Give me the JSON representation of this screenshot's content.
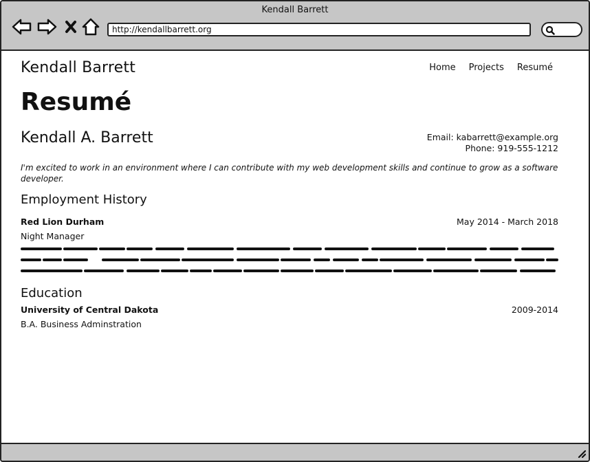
{
  "window": {
    "title": "Kendall Barrett"
  },
  "browser": {
    "url": "http://kendallbarrett.org",
    "icons": [
      "back-arrow-icon",
      "forward-arrow-icon",
      "stop-icon",
      "home-icon",
      "search-icon",
      "resize-grip-icon"
    ]
  },
  "site": {
    "title": "Kendall Barrett",
    "nav": [
      "Home",
      "Projects",
      "Resumé"
    ]
  },
  "resume": {
    "heading": "Resumé",
    "name": "Kendall A. Barrett",
    "email": "Email: kabarrett@example.org",
    "phone": "Phone: 919-555-1212",
    "objective": "I'm excited to work in an environment where I can contribute with my web development skills and continue to grow as a software developer.",
    "employment": {
      "heading": "Employment History",
      "org": "Red Lion Durham",
      "dates": "May 2014 - March 2018",
      "role": "Night Manager"
    },
    "education": {
      "heading": "Education",
      "org": "University of Central Dakota",
      "dates": "2009-2014",
      "degree": "B.A. Business Adminstration"
    }
  },
  "colors": {
    "chrome": "#c6c6c6",
    "border": "#222222",
    "background": "#ffffff",
    "text": "#111111"
  }
}
